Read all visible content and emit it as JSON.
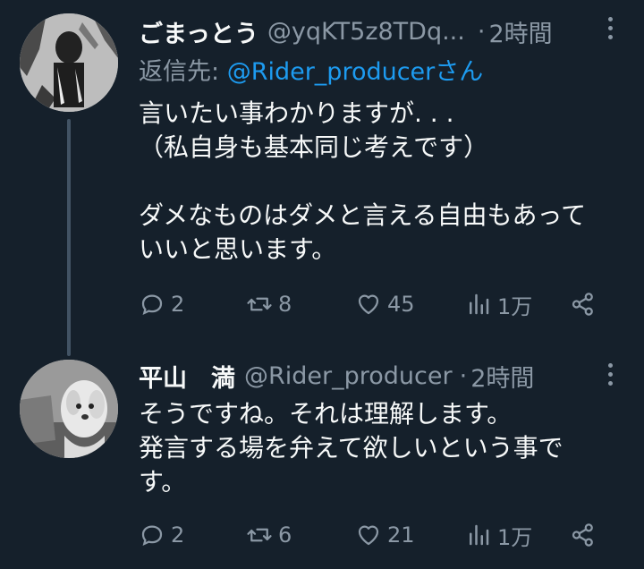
{
  "tweets": [
    {
      "author_name": "ごまっとう",
      "author_handle": "@yqKT5z8TDq...",
      "separator": "·",
      "time": "2時間",
      "reply_prefix": "返信先: ",
      "reply_to": "@Rider_producerさん",
      "text": "言いたい事わかりますが. . .\n（私自身も基本同じ考えです）\n\nダメなものはダメと言える自由もあって\nいいと思います。",
      "replies": "2",
      "retweets": "8",
      "likes": "45",
      "views": "1万"
    },
    {
      "author_name": "平山　満",
      "author_handle": "@Rider_producer",
      "separator": "·",
      "time": "2時間",
      "text": "そうですね。それは理解します。\n発言する場を弁えて欲しいという事で\nす。",
      "replies": "2",
      "retweets": "6",
      "likes": "21",
      "views": "1万"
    }
  ],
  "colors": {
    "background": "#15202b",
    "text": "#f7f9f9",
    "muted": "#8b98a5",
    "link": "#1d9bf0"
  },
  "icons": [
    "reply-icon",
    "retweet-icon",
    "like-icon",
    "views-icon",
    "share-icon",
    "more-icon"
  ]
}
